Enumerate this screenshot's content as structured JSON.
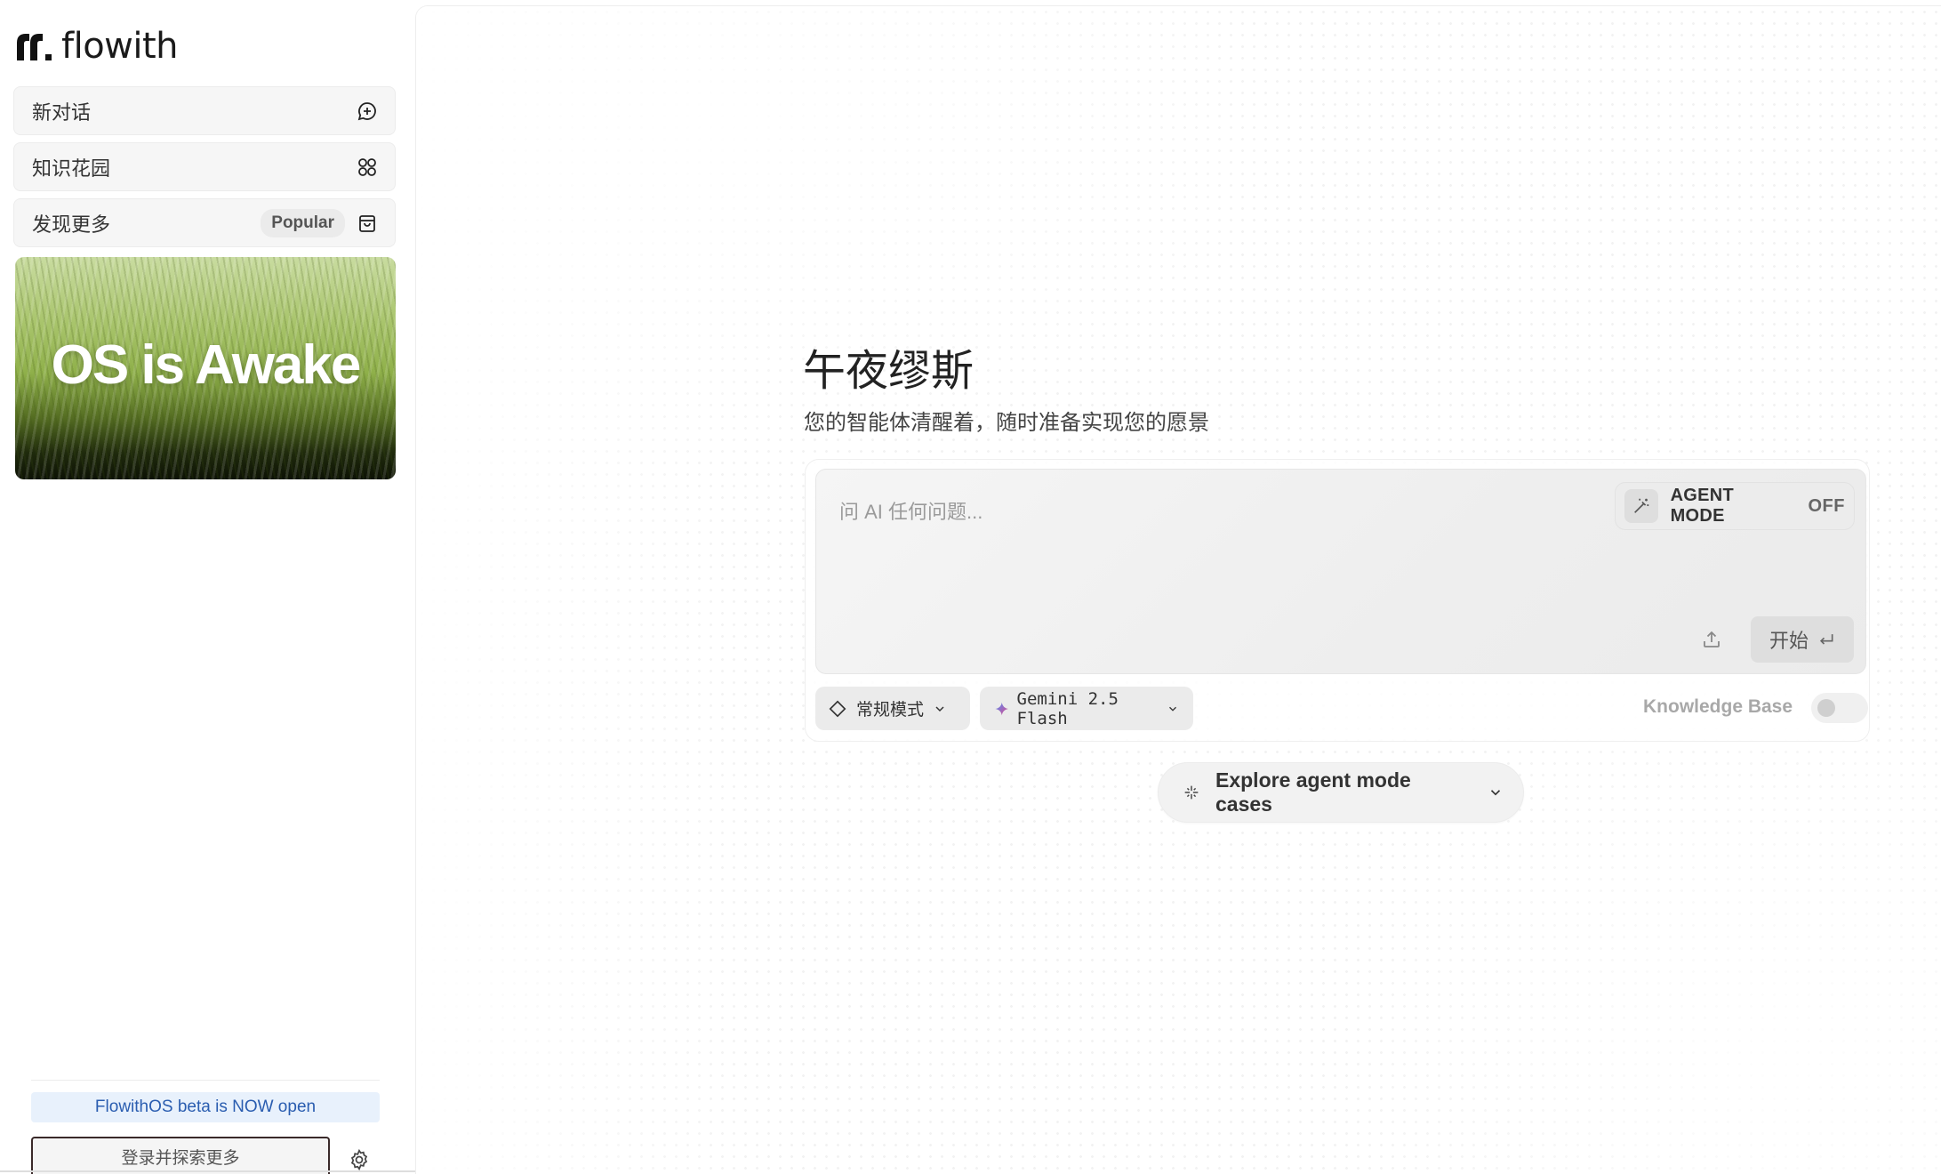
{
  "app": {
    "logo_text": "flowith"
  },
  "sidebar": {
    "items": [
      {
        "label": "新对话",
        "icon": "chat-plus-icon"
      },
      {
        "label": "知识花园",
        "icon": "knowledge-garden-icon"
      },
      {
        "label": "发现更多",
        "badge": "Popular",
        "icon": "shopping-bag-icon"
      }
    ],
    "banner_text": "OS is Awake",
    "beta_text": "FlowithOS beta is NOW open",
    "login_label": "登录并探索更多"
  },
  "main": {
    "title": "午夜缪斯",
    "subtitle": "您的智能体清醒着，随时准备实现您的愿景",
    "input_placeholder": "问 AI 任何问题...",
    "agent_mode_label": "AGENT MODE",
    "agent_mode_state": "OFF",
    "start_label": "开始",
    "mode_label": "常规模式",
    "model_label": "Gemini 2.5 Flash",
    "knowledge_base_label": "Knowledge Base",
    "knowledge_base_enabled": false,
    "explore_label": "Explore agent mode cases"
  },
  "colors": {
    "beta_bg": "#e8f1fc",
    "beta_text": "#2a5db0",
    "gemini_gradient": [
      "#4f8df5",
      "#e24a8b"
    ]
  }
}
